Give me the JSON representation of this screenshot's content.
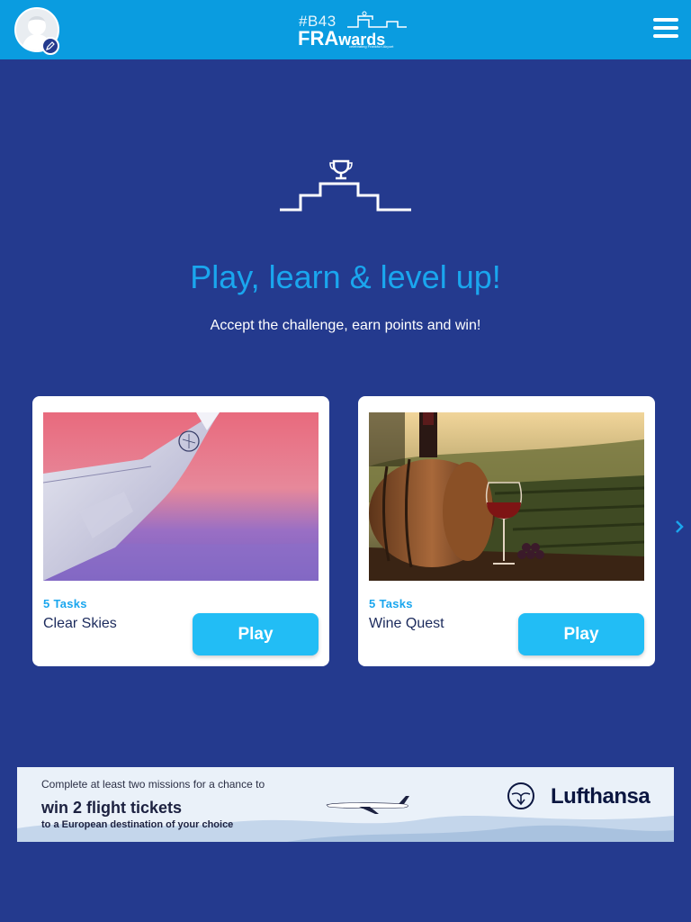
{
  "header": {
    "logo_tag": "#B43",
    "logo_main_a": "FRA",
    "logo_main_b": "wards",
    "logo_sub": "celebrating Frankfurt Airport"
  },
  "hero": {
    "title": "Play, learn & level up!",
    "subtitle": "Accept the challenge, earn points and win!"
  },
  "missions": [
    {
      "tasks": "5 Tasks",
      "title": "Clear Skies",
      "play_label": "Play"
    },
    {
      "tasks": "5 Tasks",
      "title": "Wine Quest",
      "play_label": "Play"
    }
  ],
  "banner": {
    "line1": "Complete at least two missions for a chance to",
    "line2": "win 2 flight tickets",
    "line3": "to a European destination of your choice",
    "brand": "Lufthansa"
  },
  "colors": {
    "background": "#243a8e",
    "topbar": "#0a9ce0",
    "accent": "#1aa6ee",
    "button": "#22bdf5"
  },
  "icons": [
    "avatar-icon",
    "edit-icon",
    "trophy-podium-icon",
    "menu-icon",
    "chevron-right-icon",
    "lufthansa-crane-icon"
  ]
}
